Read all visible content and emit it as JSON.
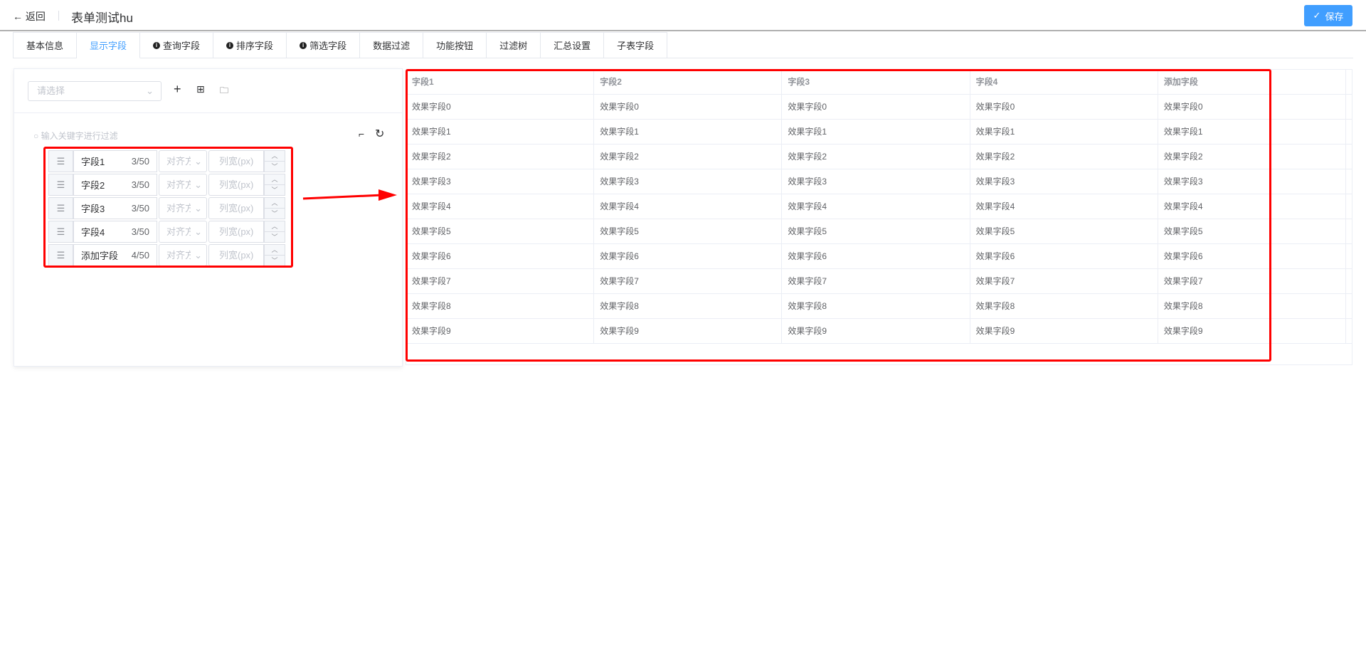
{
  "header": {
    "back_label": "返回",
    "title": "表单测试hu",
    "save_label": "保存"
  },
  "tabs": [
    {
      "label": "基本信息",
      "info": false
    },
    {
      "label": "显示字段",
      "info": false,
      "active": true
    },
    {
      "label": "查询字段",
      "info": true
    },
    {
      "label": "排序字段",
      "info": true
    },
    {
      "label": "筛选字段",
      "info": true
    },
    {
      "label": "数据过滤",
      "info": false
    },
    {
      "label": "功能按钮",
      "info": false
    },
    {
      "label": "过滤树",
      "info": false
    },
    {
      "label": "汇总设置",
      "info": false
    },
    {
      "label": "子表字段",
      "info": false
    }
  ],
  "left": {
    "select_placeholder": "请选择",
    "search_placeholder": "输入关键字进行过滤",
    "fields": [
      {
        "name": "字段1",
        "count": "3/50"
      },
      {
        "name": "字段2",
        "count": "3/50"
      },
      {
        "name": "字段3",
        "count": "3/50"
      },
      {
        "name": "字段4",
        "count": "3/50"
      },
      {
        "name": "添加字段",
        "count": "4/50"
      }
    ],
    "align_placeholder": "对齐方",
    "width_placeholder": "列宽(px)"
  },
  "table": {
    "columns": [
      "字段1",
      "字段2",
      "字段3",
      "字段4",
      "添加字段"
    ],
    "rows": [
      [
        "效果字段0",
        "效果字段0",
        "效果字段0",
        "效果字段0",
        "效果字段0"
      ],
      [
        "效果字段1",
        "效果字段1",
        "效果字段1",
        "效果字段1",
        "效果字段1"
      ],
      [
        "效果字段2",
        "效果字段2",
        "效果字段2",
        "效果字段2",
        "效果字段2"
      ],
      [
        "效果字段3",
        "效果字段3",
        "效果字段3",
        "效果字段3",
        "效果字段3"
      ],
      [
        "效果字段4",
        "效果字段4",
        "效果字段4",
        "效果字段4",
        "效果字段4"
      ],
      [
        "效果字段5",
        "效果字段5",
        "效果字段5",
        "效果字段5",
        "效果字段5"
      ],
      [
        "效果字段6",
        "效果字段6",
        "效果字段6",
        "效果字段6",
        "效果字段6"
      ],
      [
        "效果字段7",
        "效果字段7",
        "效果字段7",
        "效果字段7",
        "效果字段7"
      ],
      [
        "效果字段8",
        "效果字段8",
        "效果字段8",
        "效果字段8",
        "效果字段8"
      ],
      [
        "效果字段9",
        "效果字段9",
        "效果字段9",
        "效果字段9",
        "效果字段9"
      ]
    ]
  },
  "colors": {
    "primary": "#409eff",
    "annotation": "#ff0000"
  }
}
